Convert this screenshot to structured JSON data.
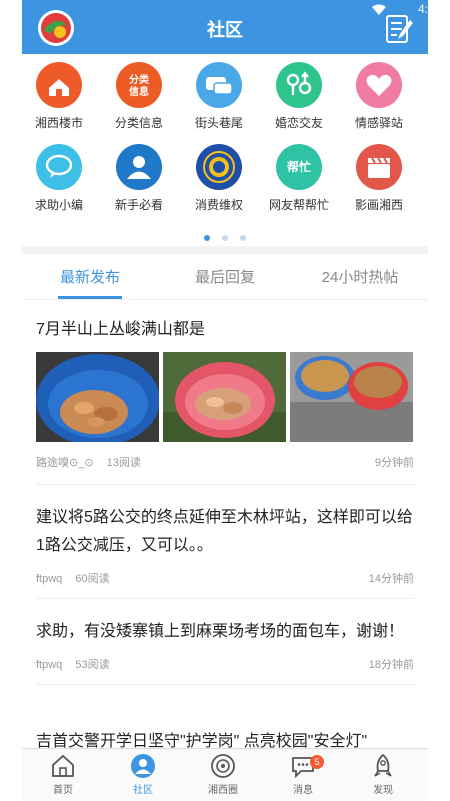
{
  "header": {
    "title": "社区",
    "status_time": "4:"
  },
  "categories": [
    {
      "label": "湘西楼市",
      "icon": "house-icon",
      "color": "#ef5a2a"
    },
    {
      "label": "分类信息",
      "icon": "classified-icon",
      "color": "#ec5b23",
      "icon_text": "分类信息"
    },
    {
      "label": "街头巷尾",
      "icon": "chat-bubbles-icon",
      "color": "#4aa8e8"
    },
    {
      "label": "婚恋交友",
      "icon": "gender-icon",
      "color": "#2fc38e"
    },
    {
      "label": "情感驿站",
      "icon": "heart-icon",
      "color": "#f07ca2"
    },
    {
      "label": "求助小编",
      "icon": "speech-bubble-icon",
      "color": "#3dbfe8"
    },
    {
      "label": "新手必看",
      "icon": "user-icon",
      "color": "#1f79c8"
    },
    {
      "label": "消费维权",
      "icon": "badge-icon",
      "color": "#1f4fa8"
    },
    {
      "label": "网友帮帮忙",
      "icon": "help-icon",
      "color": "#2fc3a6",
      "icon_text": "帮忙"
    },
    {
      "label": "影画湘西",
      "icon": "clapperboard-icon",
      "color": "#e2574a"
    }
  ],
  "tabs": [
    {
      "label": "最新发布",
      "active": true
    },
    {
      "label": "最后回复",
      "active": false
    },
    {
      "label": "24小时热帖",
      "active": false
    }
  ],
  "posts": [
    {
      "title": "7月半山上丛峻满山都是",
      "author": "路途嗅⊙_⊙",
      "views": "13阅读",
      "time": "9分钟前"
    },
    {
      "title": "建议将5路公交的终点延伸至木林坪站，这样即可以给1路公交减压，又可以。。",
      "author": "ftpwq",
      "views": "60阅读",
      "time": "14分钟前"
    },
    {
      "title": "求助，有没矮寨镇上到麻栗场考场的面包车，谢谢！",
      "author": "ftpwq",
      "views": "53阅读",
      "time": "18分钟前"
    },
    {
      "title": "吉首交警开学日坚守\"护学岗\" 点亮校园\"安全灯\""
    }
  ],
  "bottom_nav": [
    {
      "label": "首页",
      "icon": "home-icon",
      "active": false
    },
    {
      "label": "社区",
      "icon": "community-icon",
      "active": true
    },
    {
      "label": "湘西圈",
      "icon": "circle-icon",
      "active": false
    },
    {
      "label": "消息",
      "icon": "message-icon",
      "active": false,
      "badge": "5"
    },
    {
      "label": "发现",
      "icon": "discover-icon",
      "active": false
    }
  ],
  "colors": {
    "accent": "#3d95e1",
    "badge": "#f35a33"
  }
}
